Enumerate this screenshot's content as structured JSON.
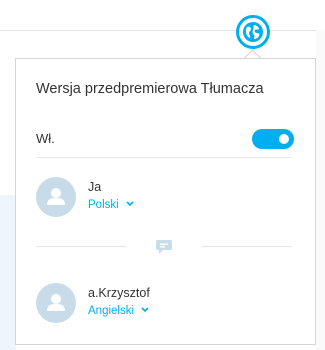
{
  "popover": {
    "title": "Wersja przedpremierowa Tłumacza",
    "toggle": {
      "label": "Wł.",
      "state": "on"
    },
    "participants": [
      {
        "name": "Ja",
        "language": "Polski"
      },
      {
        "name": "a.Krzysztof",
        "language": "Angielski"
      }
    ]
  },
  "icons": {
    "translator": "globe-icon",
    "avatar": "person-icon",
    "language_dropdown": "chevron-down-icon",
    "separator": "chat-bubble-icon"
  },
  "colors": {
    "accent": "#00aff0",
    "avatar_bg": "#c8dbe8",
    "text": "#333333"
  }
}
